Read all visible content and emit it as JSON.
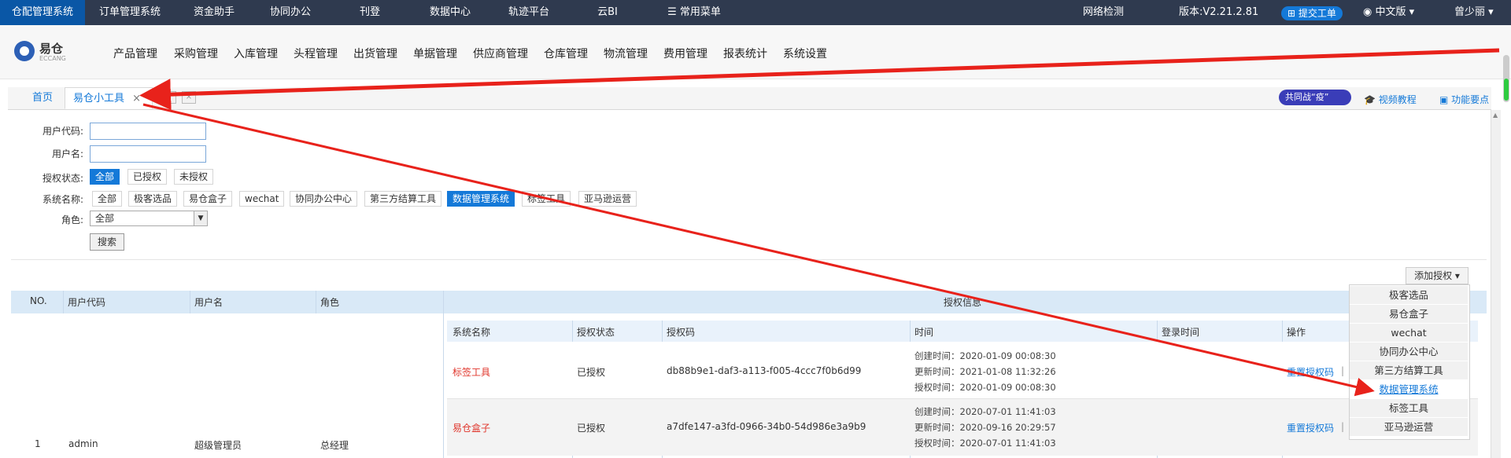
{
  "topbar": {
    "systems": [
      "仓配管理系统",
      "订单管理系统",
      "资金助手",
      "协同办公",
      "刊登",
      "数据中心",
      "轨迹平台",
      "云BI",
      "常用菜单"
    ],
    "network": "网络检测",
    "version": "版本:V2.21.2.81",
    "submit": "提交工单",
    "language": "中文版",
    "user": "曾少丽"
  },
  "logo": {
    "name": "易仓",
    "sub": "ECCANG"
  },
  "menu": [
    "产品管理",
    "采购管理",
    "入库管理",
    "头程管理",
    "出货管理",
    "单据管理",
    "供应商管理",
    "仓库管理",
    "物流管理",
    "费用管理",
    "报表统计",
    "系统设置"
  ],
  "tabs": {
    "home": "首页",
    "active": "易仓小工具",
    "close": "×"
  },
  "right_links": {
    "covid": "共同战“疫”",
    "video": "视频教程",
    "feature": "功能要点"
  },
  "form": {
    "user_code_label": "用户代码:",
    "user_name_label": "用户名:",
    "auth_status_label": "授权状态:",
    "auth_options": [
      "全部",
      "已授权",
      "未授权"
    ],
    "system_label": "系统名称:",
    "system_options": [
      "全部",
      "极客选品",
      "易仓盒子",
      "wechat",
      "协同办公中心",
      "第三方结算工具",
      "数据管理系统",
      "标签工具",
      "亚马逊运营"
    ],
    "role_label": "角色:",
    "role_value": "全部",
    "search": "搜索"
  },
  "add_auth": "添加授权",
  "dropdown": [
    "极客选品",
    "易仓盒子",
    "wechat",
    "协同办公中心",
    "第三方结算工具",
    "数据管理系统",
    "标签工具",
    "亚马逊运营"
  ],
  "table": {
    "headers": [
      "NO.",
      "用户代码",
      "用户名",
      "角色",
      "授权信息"
    ],
    "sub_headers": [
      "系统名称",
      "授权状态",
      "授权码",
      "时间",
      "登录时间",
      "操作"
    ],
    "row": {
      "no": "1",
      "code": "admin",
      "name": "超级管理员",
      "role": "总经理"
    },
    "auths": [
      {
        "system": "标签工具",
        "status": "已授权",
        "code": "db88b9e1-daf3-a113-f005-4ccc7f0b6d99",
        "created": "创建时间：2020-01-09 00:08:30",
        "updated": "更新时间：2021-01-08 11:32:26",
        "authorized": "授权时间：2020-01-09 00:08:30",
        "action": "重置授权码",
        "sep": "|"
      },
      {
        "system": "易仓盒子",
        "status": "已授权",
        "code": "a7dfe147-a3fd-0966-34b0-54d986e3a9b9",
        "created": "创建时间：2020-07-01 11:41:03",
        "updated": "更新时间：2020-09-16 20:29:57",
        "authorized": "授权时间：2020-07-01 11:41:03",
        "action": "重置授权码",
        "sep": "|"
      }
    ]
  }
}
